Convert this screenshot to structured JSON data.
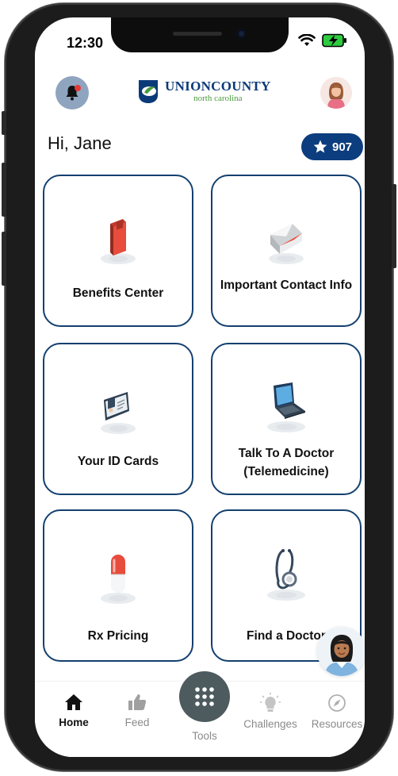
{
  "status_bar": {
    "time": "12:30"
  },
  "header": {
    "logo": {
      "main": "UNIONCOUNTY",
      "sub": "north carolina"
    },
    "notification_count": ""
  },
  "greeting": "Hi,  Jane",
  "points": {
    "value": "907"
  },
  "tiles": [
    {
      "label": "Benefits Center",
      "icon": "book-icon"
    },
    {
      "label": "Important Contact Info",
      "icon": "envelope-icon"
    },
    {
      "label": "Your ID Cards",
      "icon": "id-card-icon"
    },
    {
      "label": "Talk To A Doctor (Telemedicine)",
      "icon": "laptop-icon"
    },
    {
      "label": "Rx Pricing",
      "icon": "pill-icon"
    },
    {
      "label": "Find a Doctor",
      "icon": "stethoscope-icon"
    }
  ],
  "nav": {
    "home": "Home",
    "feed": "Feed",
    "tools": "Tools",
    "challenges": "Challenges",
    "resources": "Resources"
  },
  "colors": {
    "brand_navy": "#0c3d7e",
    "tile_border": "#14406f",
    "accent_green": "#4a9b3c",
    "battery_green": "#2ecc40",
    "notification_red": "#e53935"
  }
}
